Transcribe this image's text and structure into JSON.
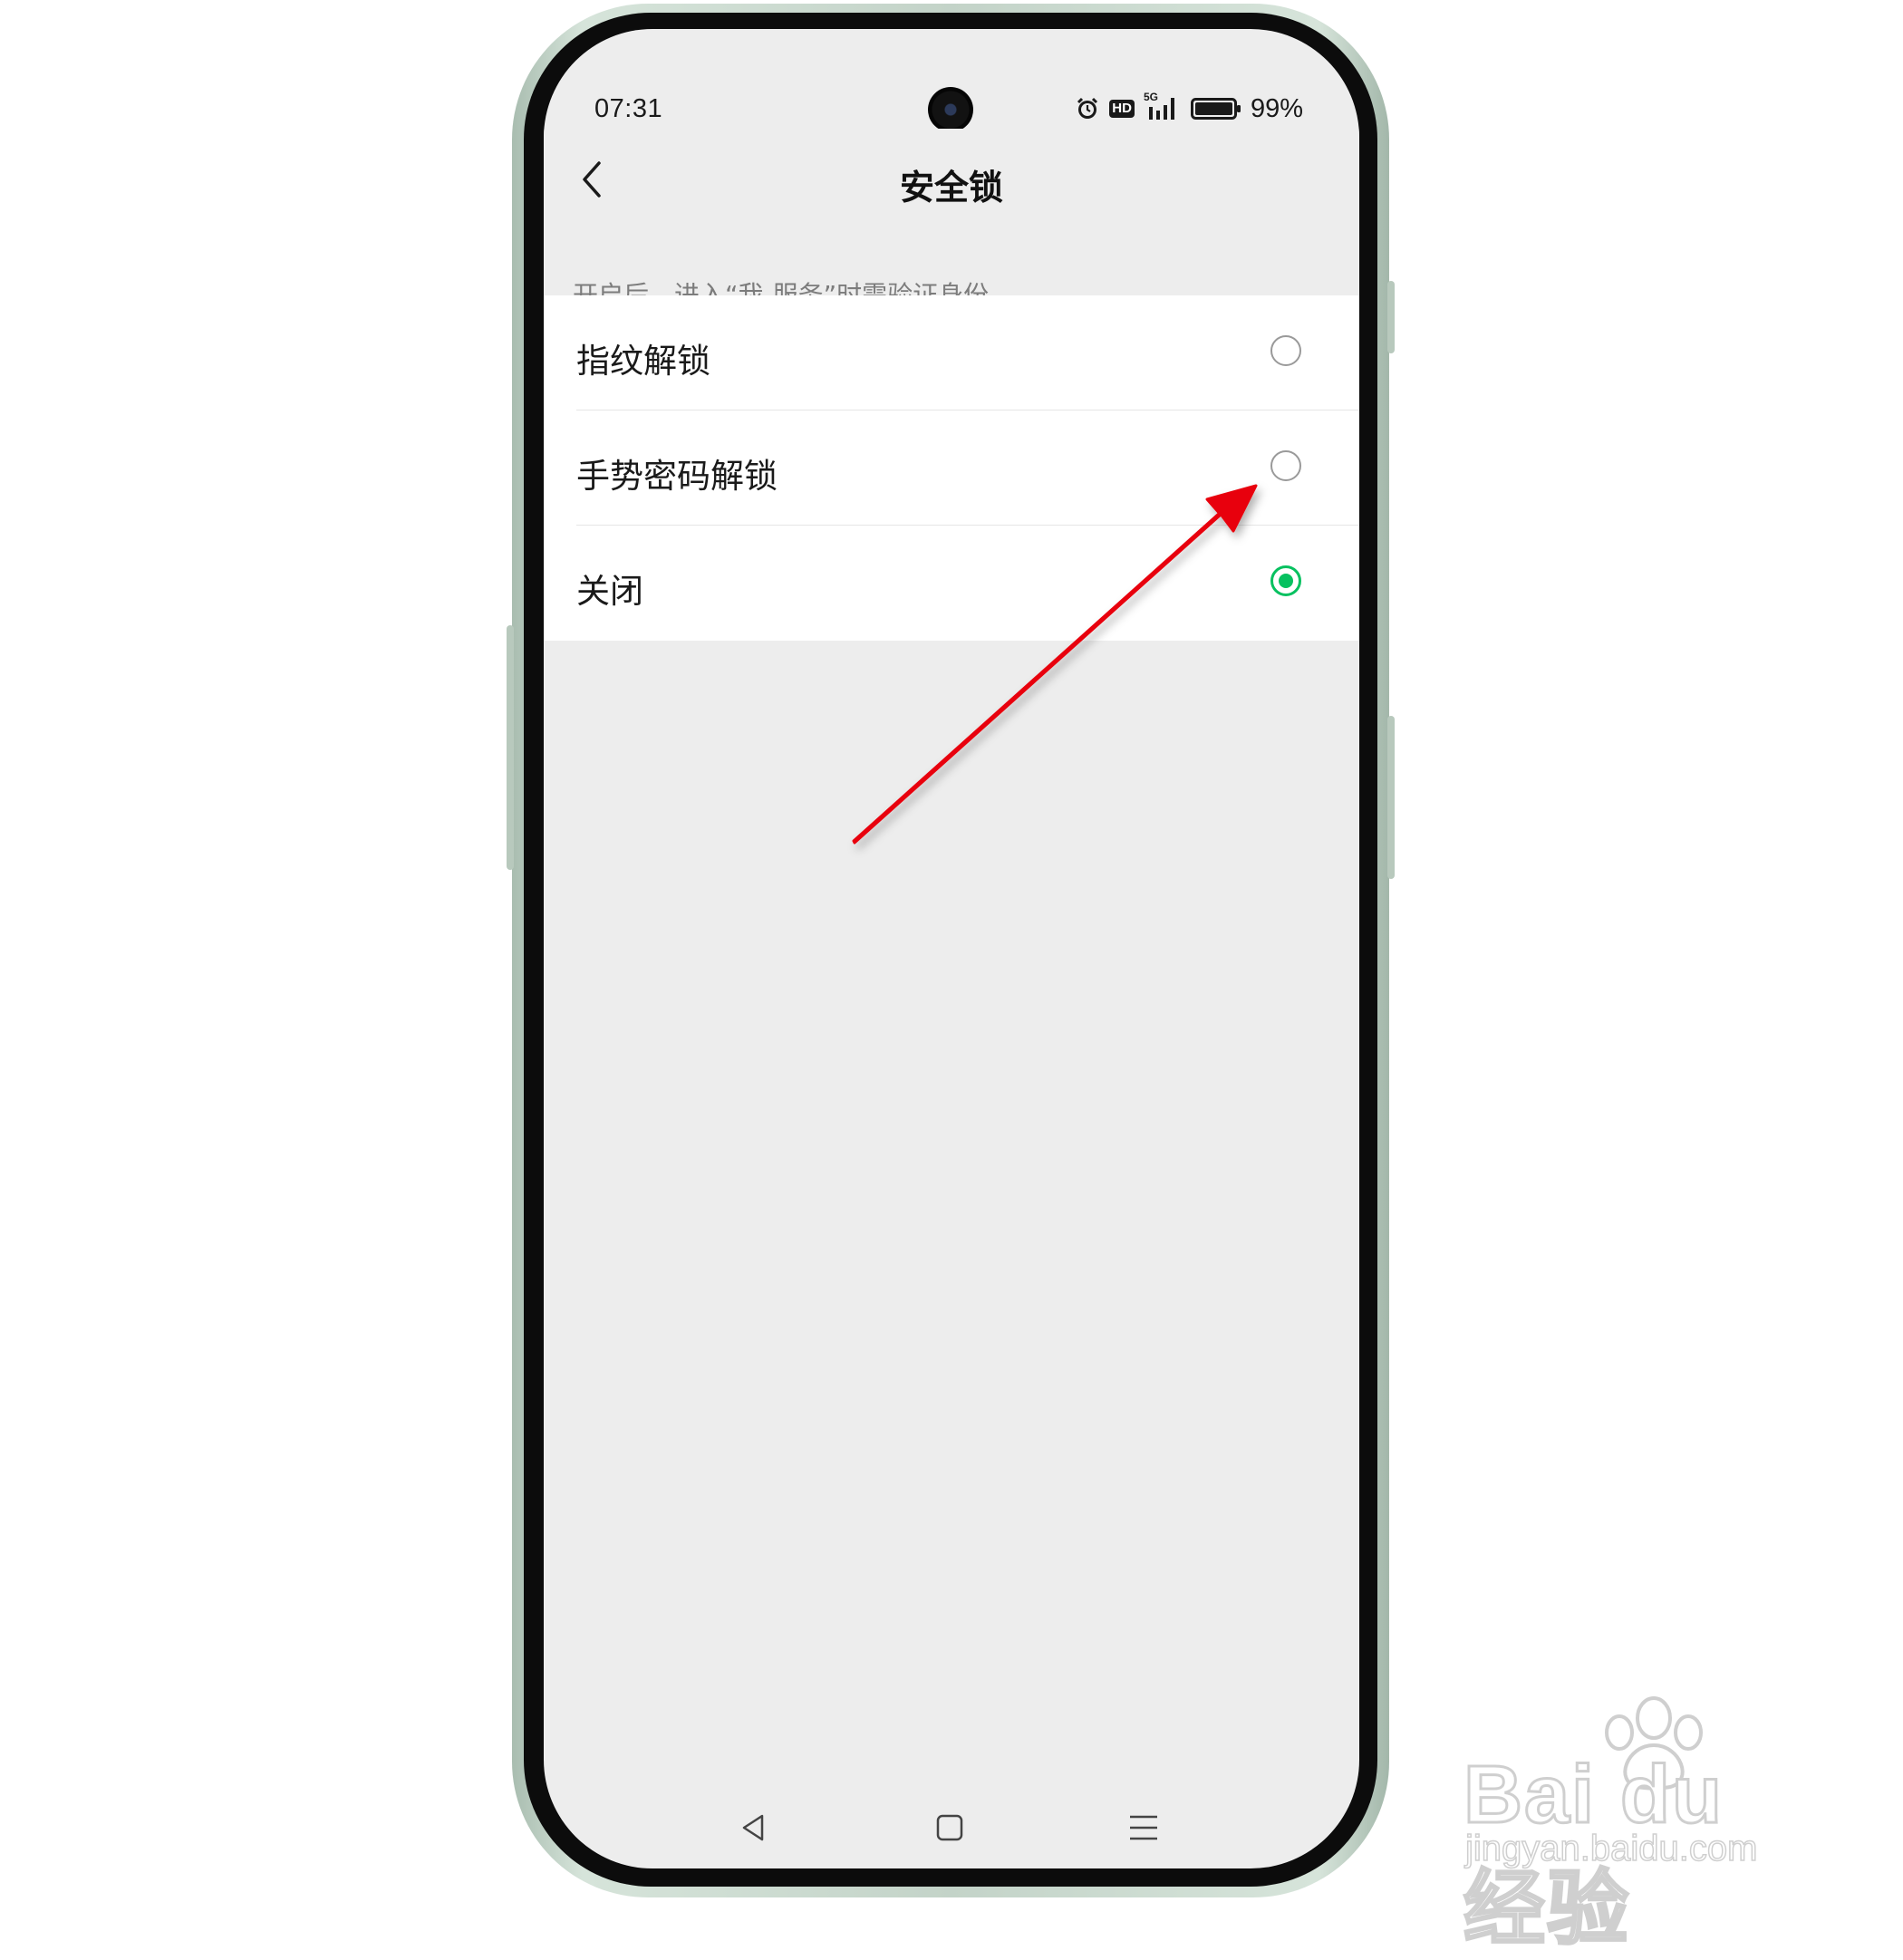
{
  "status_bar": {
    "time": "07:31",
    "hd_badge": "HD",
    "signal_tech": "5G",
    "battery": "99%"
  },
  "header": {
    "title": "安全锁",
    "back_icon": "chevron-left-icon"
  },
  "description": "开启后，进入“我-服务”时需验证身份",
  "options": [
    {
      "label": "指纹解锁",
      "selected": false
    },
    {
      "label": "手势密码解锁",
      "selected": false
    },
    {
      "label": "关闭",
      "selected": true
    }
  ],
  "colors": {
    "accent": "#07c160",
    "annotation_arrow": "#e8000b",
    "background": "#ededed"
  },
  "watermark": {
    "brand": "Bai du 经验",
    "url": "jingyan.baidu.com"
  }
}
